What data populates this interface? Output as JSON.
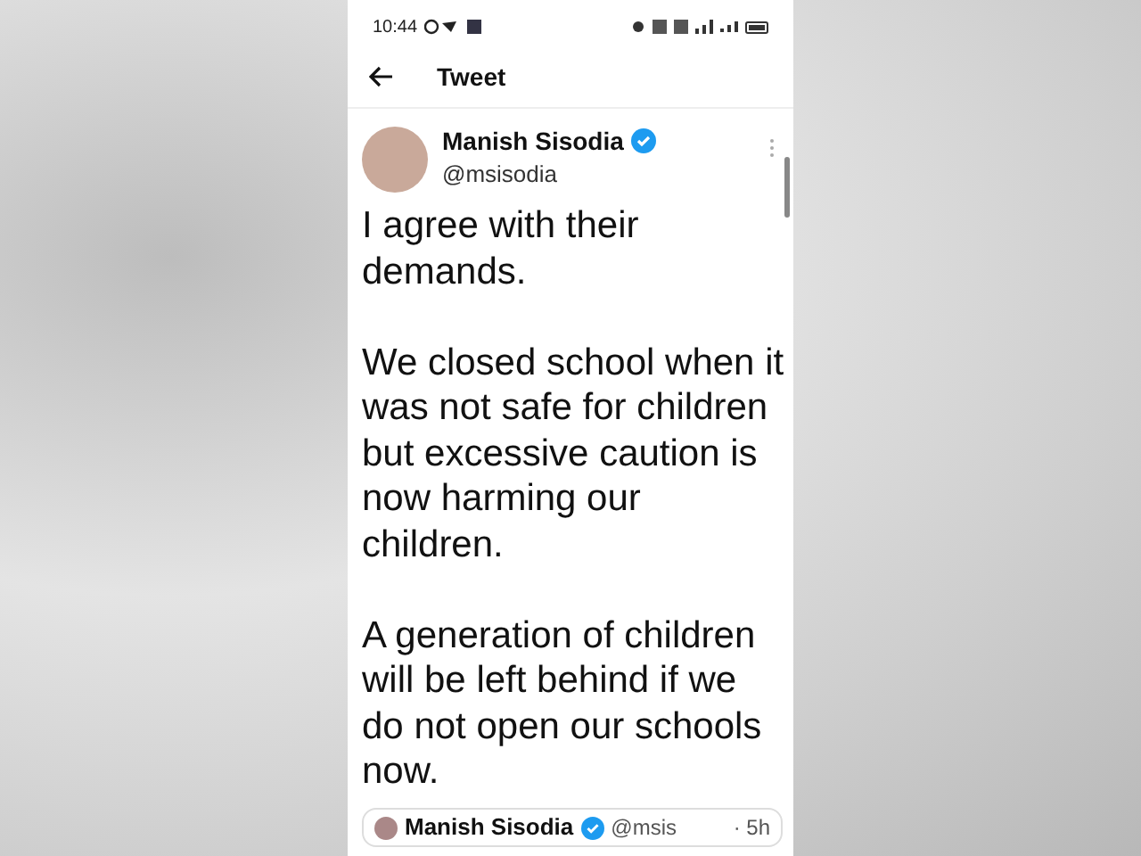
{
  "status_bar": {
    "time": "10:44"
  },
  "header": {
    "title": "Tweet"
  },
  "tweet": {
    "author": "Manish Sisodia",
    "verified": true,
    "handle": "@msisodia",
    "paragraphs": [
      "I agree with their demands.",
      "We closed school when it was not safe for children but excessive caution is now harming our children.",
      "A generation of children will be left behind if we do not open our schools now."
    ]
  },
  "quoted_tweet": {
    "author": "Manish Sisodia",
    "verified": true,
    "handle": "@msis",
    "time": "· 5h"
  }
}
